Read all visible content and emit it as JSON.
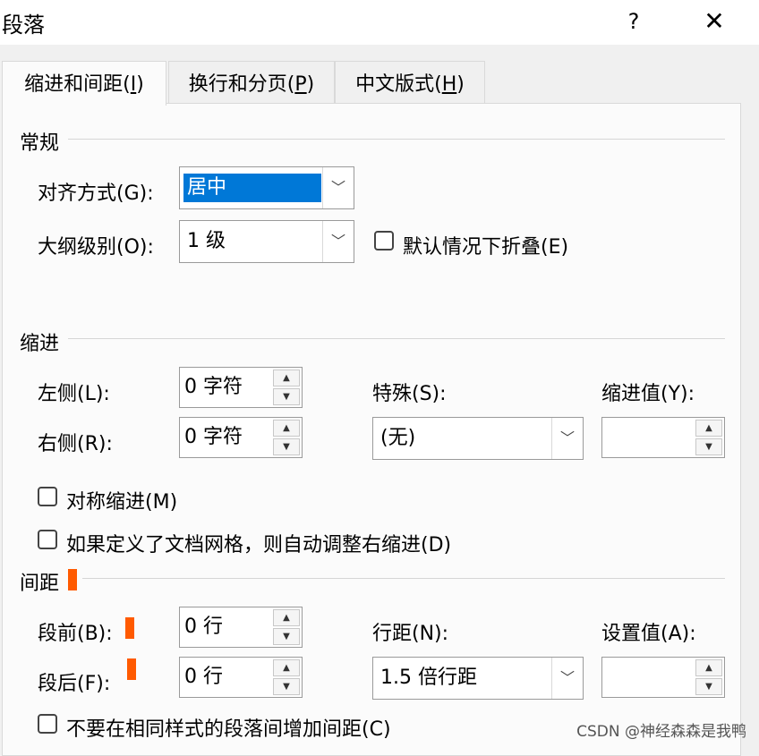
{
  "window": {
    "title": "段落",
    "help_label": "?",
    "close_label": "✕"
  },
  "tabs": [
    {
      "label": "缩进和间距",
      "hotkey": "I"
    },
    {
      "label": "换行和分页",
      "hotkey": "P"
    },
    {
      "label": "中文版式",
      "hotkey": "H"
    }
  ],
  "general": {
    "heading": "常规",
    "alignment_label": "对齐方式(G):",
    "alignment_value": "居中",
    "outline_label": "大纲级别(O):",
    "outline_value": "1 级",
    "collapse_label": "默认情况下折叠(E)"
  },
  "indent": {
    "heading": "缩进",
    "left_label": "左侧(L):",
    "left_value": "0 字符",
    "right_label": "右侧(R):",
    "right_value": "0 字符",
    "special_label": "特殊(S):",
    "special_value": "(无)",
    "indent_value_label": "缩进值(Y):",
    "indent_value": "",
    "mirror_label": "对称缩进(M)",
    "grid_label": "如果定义了文档网格，则自动调整右缩进(D)"
  },
  "spacing": {
    "heading": "间距",
    "before_label": "段前(B):",
    "before_value": "0 行",
    "after_label": "段后(F):",
    "after_value": "0 行",
    "line_label": "行距(N):",
    "line_value": "1.5 倍行距",
    "at_label": "设置值(A):",
    "at_value": "",
    "no_space_label": "不要在相同样式的段落间增加间距(C)"
  },
  "watermark": "CSDN @神经森森是我鸭",
  "colors": {
    "highlight": "#0078d7",
    "annotation_marker": "#ff5a00"
  }
}
